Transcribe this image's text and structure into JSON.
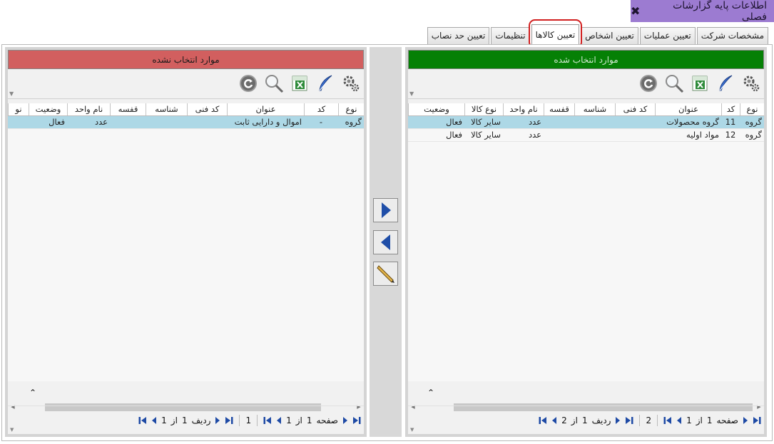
{
  "window": {
    "title": "اطلاعات پایه گزارشات فصلی"
  },
  "tabs": [
    {
      "label": "مشخصات شرکت"
    },
    {
      "label": "تعیین عملیات"
    },
    {
      "label": "تعیین اشخاص"
    },
    {
      "label": "تعیین کالاها",
      "active": true
    },
    {
      "label": "تنظیمات"
    },
    {
      "label": "تعیین حد نصاب"
    }
  ],
  "selected_panel": {
    "header": "موارد انتخاب شده",
    "columns": [
      "نوع",
      "کد",
      "عنوان",
      "کد فنی",
      "شناسه",
      "قفسه",
      "نام واحد",
      "نوع کالا",
      "وضعیت"
    ],
    "rows": [
      {
        "type": "گروه",
        "code": "11",
        "title": "گروه محصولات",
        "tech_code": "",
        "id": "",
        "shelf": "",
        "unit": "عدد",
        "item_type": "سایر کالا",
        "status": "فعال"
      },
      {
        "type": "گروه",
        "code": "12",
        "title": "مواد اولیه",
        "tech_code": "",
        "id": "",
        "shelf": "",
        "unit": "عدد",
        "item_type": "سایر کالا",
        "status": "فعال"
      }
    ],
    "pager": {
      "page_label": "صفحه",
      "page_num": "1",
      "of_label": "از",
      "page_total": "1",
      "count": "2",
      "row_label": "ردیف",
      "row_num": "1",
      "row_of_label": "از",
      "row_total": "2"
    }
  },
  "unselected_panel": {
    "header": "موارد انتخاب نشده",
    "columns": [
      "نوع",
      "کد",
      "عنوان",
      "کد فنی",
      "شناسه",
      "قفسه",
      "نام واحد",
      "وضعیت",
      "نو"
    ],
    "rows": [
      {
        "type": "گروه",
        "code": "-",
        "title": "اموال و دارایی ثابت",
        "tech_code": "",
        "id": "",
        "shelf": "",
        "unit": "عدد",
        "status": "فعال",
        "extra": ""
      }
    ],
    "pager": {
      "page_label": "صفحه",
      "page_num": "1",
      "of_label": "از",
      "page_total": "1",
      "count": "1",
      "row_label": "ردیف",
      "row_num": "1",
      "row_of_label": "از",
      "row_total": "1"
    }
  },
  "colors": {
    "title_bar": "#9c7bd1",
    "selected_header": "#058005",
    "unselected_header": "#d25f5f",
    "row_highlight": "#add8e6",
    "active_tab_outline": "#d11f1f",
    "pager_icon": "#1e4aa5"
  },
  "icons": {
    "toolbar": [
      "settings-gear-icon",
      "edit-feather-icon",
      "excel-export-icon",
      "search-magnifier-icon",
      "refresh-icon"
    ],
    "middle": [
      "move-right-arrow-icon",
      "move-left-arrow-icon",
      "edit-pencil-icon"
    ]
  }
}
